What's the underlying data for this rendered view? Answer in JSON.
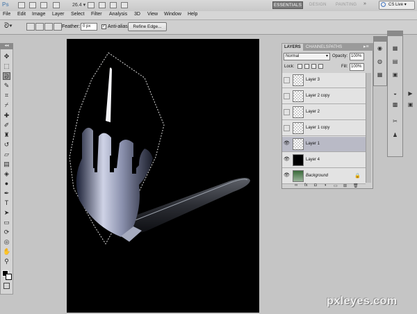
{
  "app": {
    "logo": "Ps",
    "zoom": "26.4",
    "zoom_arrow": "▾",
    "workspaces": {
      "essentials": "ESSENTIALS",
      "design": "DESIGN",
      "painting": "PAINTING",
      "more": "»"
    },
    "cs_live": "CS Live",
    "cs_live_arrow": "▾"
  },
  "menu": [
    "File",
    "Edit",
    "Image",
    "Layer",
    "Select",
    "Filter",
    "Analysis",
    "3D",
    "View",
    "Window",
    "Help"
  ],
  "options": {
    "feather_label": "Feather:",
    "feather_value": "0 px",
    "antialias_label": "Anti-alias",
    "antialias_check": "✓",
    "refine_label": "Refine Edge..."
  },
  "tools": {
    "collapse": "◂◂",
    "items": [
      {
        "name": "move-tool",
        "glyph": "✥"
      },
      {
        "name": "marquee-tool",
        "glyph": "⬚"
      },
      {
        "name": "lasso-tool",
        "glyph": "ᘐ"
      },
      {
        "name": "quick-select-tool",
        "glyph": "✎"
      },
      {
        "name": "crop-tool",
        "glyph": "⌗"
      },
      {
        "name": "eyedropper-tool",
        "glyph": "⌿"
      },
      {
        "name": "healing-tool",
        "glyph": "✚"
      },
      {
        "name": "brush-tool",
        "glyph": "✐"
      },
      {
        "name": "stamp-tool",
        "glyph": "♜"
      },
      {
        "name": "history-brush-tool",
        "glyph": "↺"
      },
      {
        "name": "eraser-tool",
        "glyph": "▱"
      },
      {
        "name": "gradient-tool",
        "glyph": "▤"
      },
      {
        "name": "blur-tool",
        "glyph": "◈"
      },
      {
        "name": "dodge-tool",
        "glyph": "●"
      },
      {
        "name": "pen-tool",
        "glyph": "✒"
      },
      {
        "name": "type-tool",
        "glyph": "T"
      },
      {
        "name": "path-select-tool",
        "glyph": "➤"
      },
      {
        "name": "shape-tool",
        "glyph": "▭"
      },
      {
        "name": "3d-rotate-tool",
        "glyph": "⟳"
      },
      {
        "name": "3d-orbit-tool",
        "glyph": "◎"
      },
      {
        "name": "hand-tool",
        "glyph": "✋"
      },
      {
        "name": "zoom-tool",
        "glyph": "⚲"
      }
    ]
  },
  "layers_panel": {
    "tabs": [
      "LAYERS",
      "CHANNELS",
      "PATHS"
    ],
    "menu": "▸≡",
    "blend_mode": "Normal",
    "blend_arrow": "▾",
    "opacity_label": "Opacity:",
    "opacity_value": "100%",
    "lock_label": "Lock:",
    "fill_label": "Fill:",
    "fill_value": "100%",
    "background_lock": "🔒",
    "layers": [
      {
        "name": "Layer 3",
        "visible": false,
        "selected": false
      },
      {
        "name": "Layer 2 copy",
        "visible": false,
        "selected": false
      },
      {
        "name": "Layer 2",
        "visible": false,
        "selected": false
      },
      {
        "name": "Layer 1 copy",
        "visible": false,
        "selected": false
      },
      {
        "name": "Layer 1",
        "visible": true,
        "selected": true
      },
      {
        "name": "Layer 4",
        "visible": true,
        "selected": false
      },
      {
        "name": "Background",
        "visible": true,
        "selected": false
      }
    ],
    "footer_icons": [
      "∞",
      "fx",
      "◘",
      "◑",
      "▭",
      "⊞",
      "🗑"
    ],
    "eye_glyph": "👁"
  },
  "watermark": "pxleyes.com"
}
